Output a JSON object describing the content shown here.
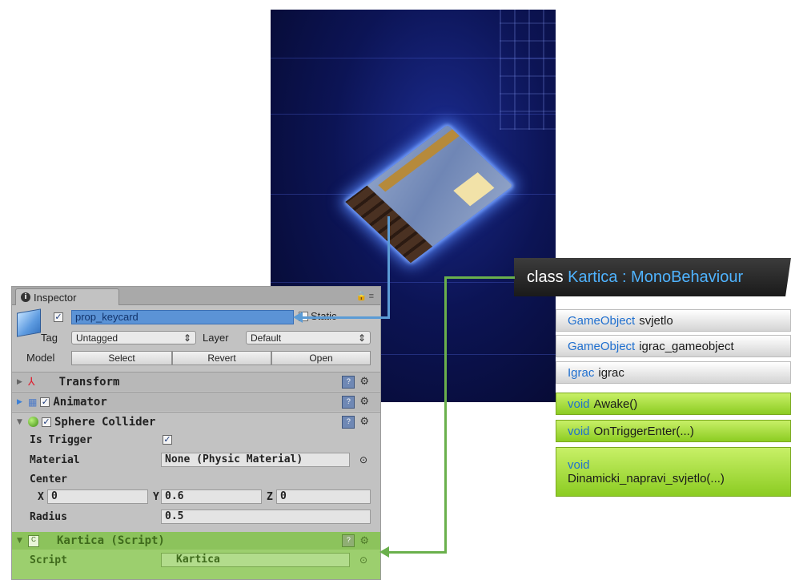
{
  "inspector": {
    "tab_label": "Inspector",
    "object_name": "prop_keycard",
    "static_label": "Static",
    "tag_label": "Tag",
    "tag_value": "Untagged",
    "layer_label": "Layer",
    "layer_value": "Default",
    "model_label": "Model",
    "model_buttons": [
      "Select",
      "Revert",
      "Open"
    ],
    "components": {
      "transform": "Transform",
      "animator": "Animator",
      "sphere_collider": "Sphere Collider",
      "script": "Kartica (Script)"
    },
    "collider": {
      "is_trigger_label": "Is Trigger",
      "material_label": "Material",
      "material_value": "None (Physic Material)",
      "center_label": "Center",
      "x_label": "X",
      "x_value": "0",
      "y_label": "Y",
      "y_value": "0.6",
      "z_label": "Z",
      "z_value": "0",
      "radius_label": "Radius",
      "radius_value": "0.5"
    },
    "script": {
      "script_label": "Script",
      "script_value": "Kartica"
    }
  },
  "class_diagram": {
    "title_keyword": "class",
    "title_name": "Kartica : MonoBehaviour",
    "members": [
      {
        "type": "GameObject",
        "name": "svjetlo",
        "kind": "field"
      },
      {
        "type": "GameObject",
        "name": "igrac_gameobject",
        "kind": "field"
      },
      {
        "type": "Igrac",
        "name": "igrac",
        "kind": "field"
      },
      {
        "type": "void",
        "name": "Awake()",
        "kind": "method"
      },
      {
        "type": "void",
        "name": "OnTriggerEnter(...)",
        "kind": "method"
      },
      {
        "type": "void",
        "name": "Dinamicki_napravi_svjetlo(...)",
        "kind": "method"
      }
    ]
  },
  "colors": {
    "type_blue": "#1f6fcf",
    "class_name_blue": "#4fb3ff",
    "connector_blue": "#5b9bd5",
    "connector_green": "#6ab04c",
    "method_green": "#8ccc22"
  }
}
